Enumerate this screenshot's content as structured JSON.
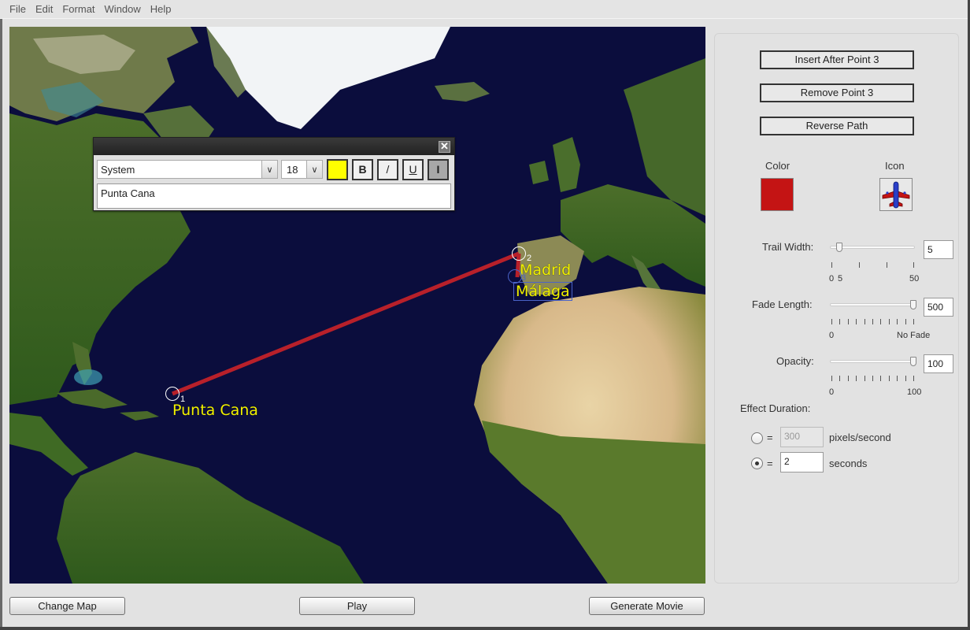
{
  "menu": [
    "File",
    "Edit",
    "Format",
    "Window",
    "Help"
  ],
  "text_editor": {
    "font": "System",
    "size": "18",
    "text_color": "#ffff00",
    "bold_label": "B",
    "italic_label": "/",
    "underline_label": "U",
    "cursor_label": "I",
    "text_value": "Punta Cana",
    "close_label": "✕"
  },
  "map": {
    "route_color": "#b8202a",
    "points": [
      {
        "number": "1",
        "label": "Punta Cana"
      },
      {
        "number": "2",
        "label": "Madrid"
      },
      {
        "number": "3",
        "label": "Málaga"
      }
    ]
  },
  "panel": {
    "insert_button": "Insert After Point 3",
    "remove_button": "Remove Point 3",
    "reverse_button": "Reverse Path",
    "color_label": "Color",
    "color_value": "#c41414",
    "icon_label": "Icon",
    "icon_name": "airplane-icon",
    "trail_width": {
      "label": "Trail Width:",
      "value": "5",
      "min_label": "0",
      "mark_label": "5",
      "max_label": "50",
      "fraction": 0.1
    },
    "fade_length": {
      "label": "Fade Length:",
      "value": "500",
      "min_label": "0",
      "max_label": "No Fade",
      "fraction": 1.0
    },
    "opacity": {
      "label": "Opacity:",
      "value": "100",
      "min_label": "0",
      "max_label": "100",
      "fraction": 1.0
    },
    "effect_duration": {
      "label": "Effect Duration:",
      "eq": "=",
      "speed_value": "300",
      "speed_unit": "pixels/second",
      "seconds_value": "2",
      "seconds_unit": "seconds",
      "selected": "seconds"
    }
  },
  "bottom": {
    "change_map": "Change Map",
    "play": "Play",
    "generate_movie": "Generate Movie"
  }
}
